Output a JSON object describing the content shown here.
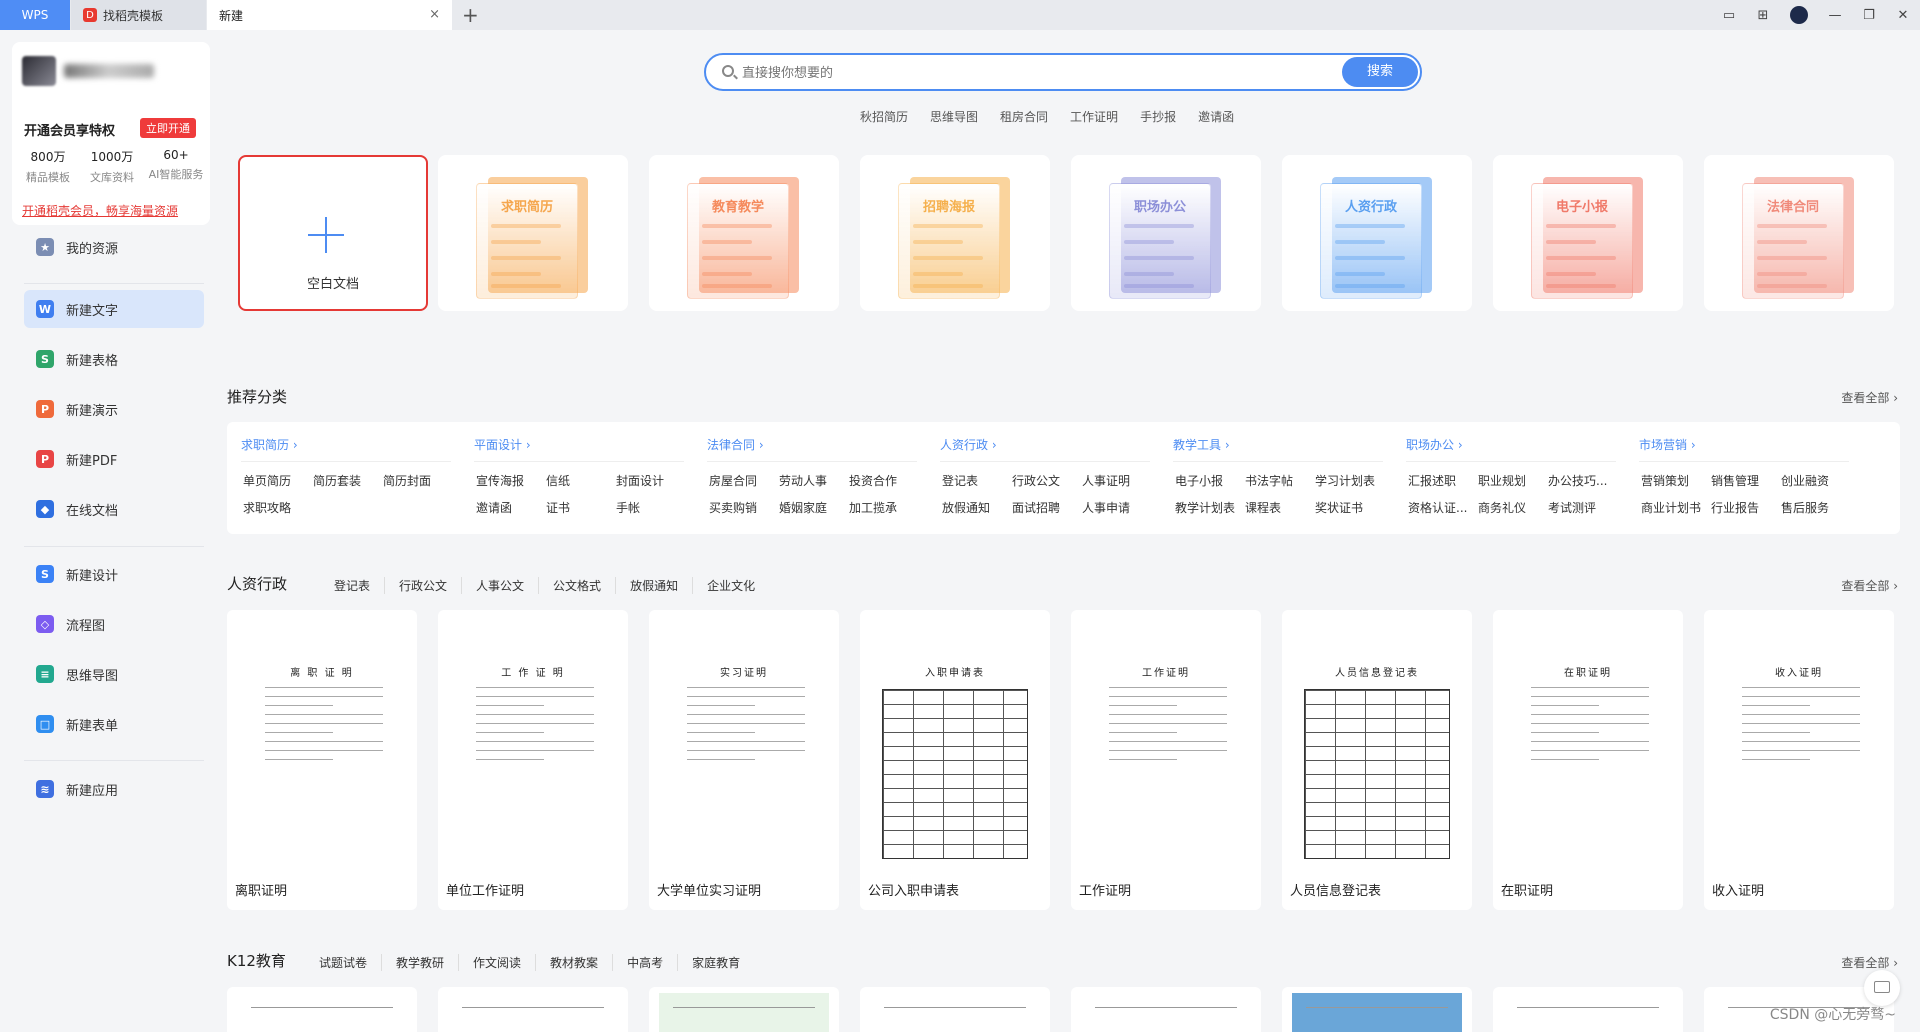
{
  "tabs": {
    "wps": "WPS",
    "template": "找稻壳模板",
    "new": "新建",
    "close": "×",
    "add": "+"
  },
  "user": {
    "vip_title": "开通会员享特权",
    "vip_button": "立即开通",
    "stats": [
      {
        "num": "800万",
        "label": "精品模板"
      },
      {
        "num": "1000万",
        "label": "文库资料"
      },
      {
        "num": "60+",
        "label": "AI智能服务"
      }
    ],
    "vip_link": "开通稻壳会员，畅享海量资源"
  },
  "nav": [
    {
      "label": "我的资源",
      "icon": "star-icon",
      "color": "#7b8db3",
      "glyph": "★"
    },
    {
      "label": "新建文字",
      "icon": "writer-icon",
      "color": "#3f7ef0",
      "glyph": "W"
    },
    {
      "label": "新建表格",
      "icon": "spreadsheet-icon",
      "color": "#2fa56a",
      "glyph": "S"
    },
    {
      "label": "新建演示",
      "icon": "presentation-icon",
      "color": "#ef6a3b",
      "glyph": "P"
    },
    {
      "label": "新建PDF",
      "icon": "pdf-icon",
      "color": "#e84545",
      "glyph": "P"
    },
    {
      "label": "在线文档",
      "icon": "online-doc-icon",
      "color": "#2f6fe0",
      "glyph": "◆"
    },
    {
      "label": "新建设计",
      "icon": "design-icon",
      "color": "#3b82f6",
      "glyph": "S"
    },
    {
      "label": "流程图",
      "icon": "flowchart-icon",
      "color": "#7c5cf0",
      "glyph": "◇"
    },
    {
      "label": "思维导图",
      "icon": "mindmap-icon",
      "color": "#22a88f",
      "glyph": "≡"
    },
    {
      "label": "新建表单",
      "icon": "form-icon",
      "color": "#2f8ef0",
      "glyph": "□"
    },
    {
      "label": "新建应用",
      "icon": "app-icon",
      "color": "#3f6fe0",
      "glyph": "≋"
    }
  ],
  "search": {
    "placeholder": "直接搜你想要的",
    "button": "搜索",
    "hot": [
      "秋招简历",
      "思维导图",
      "租房合同",
      "工作证明",
      "手抄报",
      "邀请函"
    ]
  },
  "blank_doc": "空白文档",
  "categories": [
    {
      "title": "求职简历",
      "color": "#f5a64d"
    },
    {
      "title": "教育教学",
      "color": "#f58a5c"
    },
    {
      "title": "招聘海报",
      "color": "#f5b04d"
    },
    {
      "title": "职场办公",
      "color": "#8c8fd8"
    },
    {
      "title": "人资行政",
      "color": "#5a9ff0"
    },
    {
      "title": "电子小报",
      "color": "#f07a6a"
    },
    {
      "title": "法律合同",
      "color": "#f08a7a"
    }
  ],
  "recommend": {
    "title": "推荐分类",
    "see_all": "查看全部 ›",
    "groups": [
      {
        "head": "求职简历 ›",
        "items": [
          "单页简历",
          "简历套装",
          "简历封面",
          "求职攻略"
        ]
      },
      {
        "head": "平面设计 ›",
        "items": [
          "宣传海报",
          "信纸",
          "封面设计",
          "邀请函",
          "证书",
          "手帐"
        ]
      },
      {
        "head": "法律合同 ›",
        "items": [
          "房屋合同",
          "劳动人事",
          "投资合作",
          "买卖购销",
          "婚姻家庭",
          "加工揽承"
        ]
      },
      {
        "head": "人资行政 ›",
        "items": [
          "登记表",
          "行政公文",
          "人事证明",
          "放假通知",
          "面试招聘",
          "人事申请"
        ]
      },
      {
        "head": "教学工具 ›",
        "items": [
          "电子小报",
          "书法字帖",
          "学习计划表",
          "教学计划表",
          "课程表",
          "奖状证书"
        ]
      },
      {
        "head": "职场办公 ›",
        "items": [
          "汇报述职",
          "职业规划",
          "办公技巧...",
          "资格认证...",
          "商务礼仪",
          "考试测评"
        ]
      },
      {
        "head": "市场营销 ›",
        "items": [
          "营销策划",
          "销售管理",
          "创业融资",
          "商业计划书",
          "行业报告",
          "售后服务"
        ]
      }
    ]
  },
  "hr_section": {
    "title": "人资行政",
    "filters": [
      "登记表",
      "行政公文",
      "人事公文",
      "公文格式",
      "放假通知",
      "企业文化"
    ],
    "see_all": "查看全部 ›",
    "templates": [
      {
        "name": "离职证明",
        "preview_title": "离 职 证 明"
      },
      {
        "name": "单位工作证明",
        "preview_title": "工 作 证 明"
      },
      {
        "name": "大学单位实习证明",
        "preview_title": "实习证明"
      },
      {
        "name": "公司入职申请表",
        "preview_title": "入职申请表"
      },
      {
        "name": "工作证明",
        "preview_title": "工作证明"
      },
      {
        "name": "人员信息登记表",
        "preview_title": "人员信息登记表"
      },
      {
        "name": "在职证明",
        "preview_title": "在职证明"
      },
      {
        "name": "收入证明",
        "preview_title": "收入证明"
      }
    ]
  },
  "k12_section": {
    "title": "K12教育",
    "filters": [
      "试题试卷",
      "教学教研",
      "作文阅读",
      "教材教案",
      "中高考",
      "家庭教育"
    ],
    "see_all": "查看全部 ›"
  },
  "watermark": "CSDN @心无旁骛~"
}
